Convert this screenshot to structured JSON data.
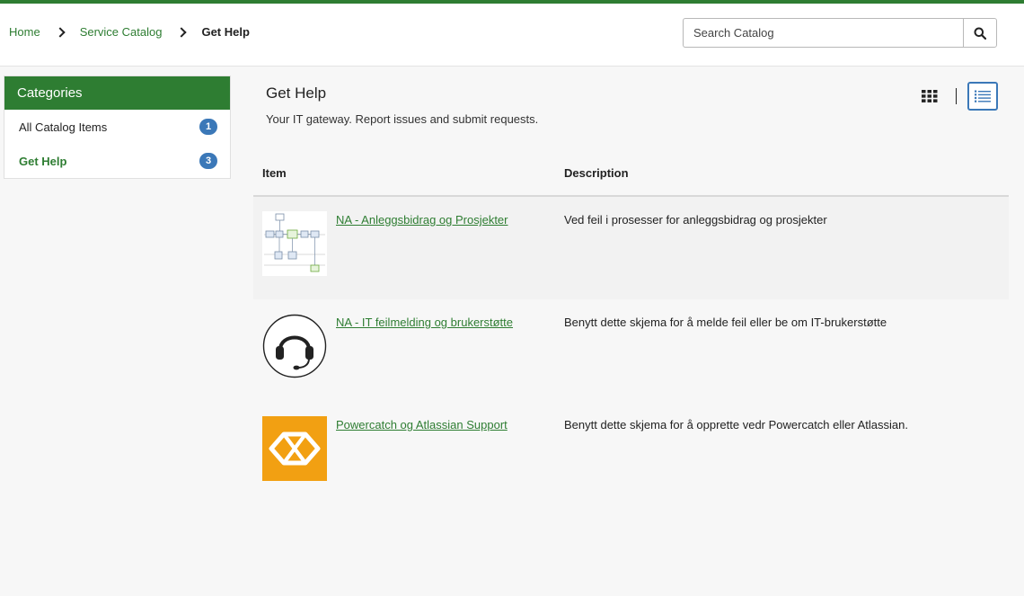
{
  "breadcrumb": {
    "home": "Home",
    "service_catalog": "Service Catalog",
    "current": "Get Help"
  },
  "search": {
    "placeholder": "Search Catalog"
  },
  "sidebar": {
    "title": "Categories",
    "items": [
      {
        "label": "All Catalog Items",
        "count": "1"
      },
      {
        "label": "Get Help",
        "count": "3"
      }
    ]
  },
  "main": {
    "title": "Get Help",
    "subtitle": "Your IT gateway. Report issues and submit requests."
  },
  "table": {
    "headers": {
      "item": "Item",
      "description": "Description"
    },
    "rows": [
      {
        "name": "NA - Anleggsbidrag og Prosjekter",
        "description": "Ved feil i prosesser for anleggsbidrag og prosjekter",
        "icon": "flowchart-diagram-icon"
      },
      {
        "name": "NA - IT feilmelding og brukerstøtte",
        "description": "Benytt dette skjema for å melde feil eller be om IT-brukerstøtte",
        "icon": "headset-icon"
      },
      {
        "name": "Powercatch og Atlassian Support",
        "description": "Benytt dette skjema for å opprette vedr Powercatch eller Atlassian.",
        "icon": "powercatch-logo-icon"
      }
    ]
  },
  "colors": {
    "accent_green": "#2e7d32",
    "badge_blue": "#3b78b8",
    "powercatch_orange": "#f2a012"
  }
}
